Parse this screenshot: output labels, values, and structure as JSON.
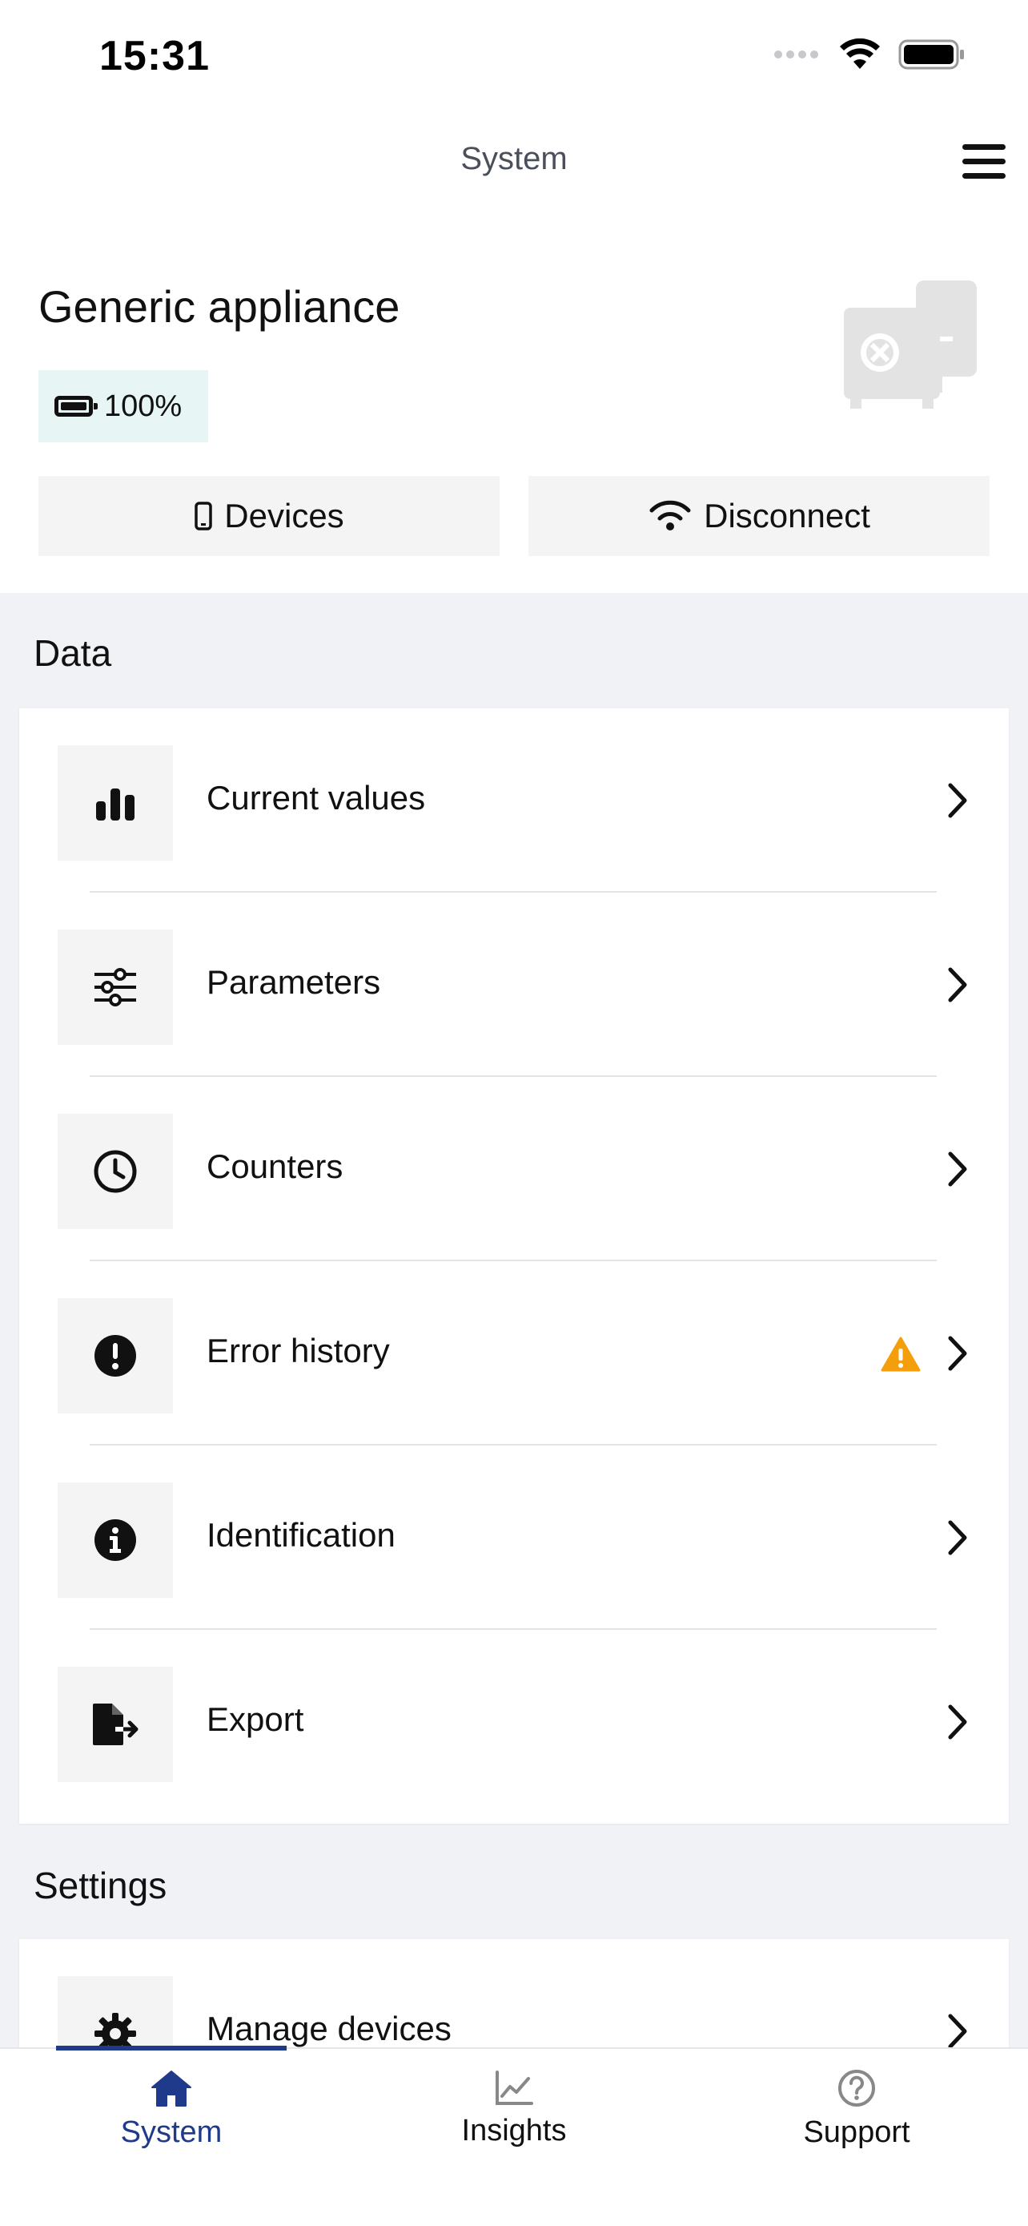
{
  "status_bar": {
    "time": "15:31"
  },
  "nav": {
    "title": "System"
  },
  "device": {
    "name": "Generic appliance",
    "battery": "100%",
    "devices_label": "Devices",
    "disconnect_label": "Disconnect"
  },
  "data_section": {
    "title": "Data",
    "items": [
      {
        "label": "Current values",
        "icon": "bar-chart-icon"
      },
      {
        "label": "Parameters",
        "icon": "sliders-icon"
      },
      {
        "label": "Counters",
        "icon": "clock-icon"
      },
      {
        "label": "Error history",
        "icon": "exclamation-circle-icon",
        "warning": true
      },
      {
        "label": "Identification",
        "icon": "info-circle-icon"
      },
      {
        "label": "Export",
        "icon": "file-export-icon"
      }
    ]
  },
  "settings_section": {
    "title": "Settings",
    "items": [
      {
        "label": "Manage devices",
        "icon": "gear-icon"
      }
    ]
  },
  "tabs": [
    {
      "label": "System",
      "icon": "home-icon",
      "active": true
    },
    {
      "label": "Insights",
      "icon": "line-chart-icon"
    },
    {
      "label": "Support",
      "icon": "help-circle-icon"
    }
  ],
  "colors": {
    "accent": "#1f3a8a",
    "warning": "#f59e0b",
    "battery_bg": "#e7f5f4"
  }
}
